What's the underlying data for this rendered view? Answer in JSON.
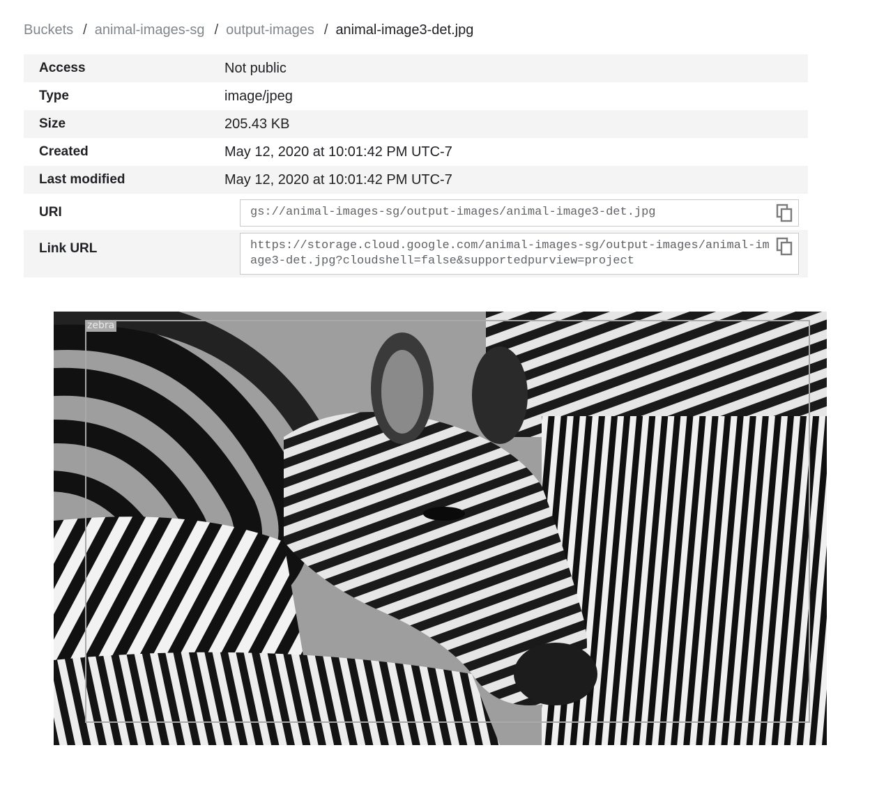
{
  "breadcrumb": {
    "items": [
      "Buckets",
      "animal-images-sg",
      "output-images"
    ],
    "separator": "/",
    "current": "animal-image3-det.jpg"
  },
  "details": {
    "access": {
      "label": "Access",
      "value": "Not public"
    },
    "type": {
      "label": "Type",
      "value": "image/jpeg"
    },
    "size": {
      "label": "Size",
      "value": "205.43 KB"
    },
    "created": {
      "label": "Created",
      "value": "May 12, 2020 at 10:01:42 PM UTC-7"
    },
    "modified": {
      "label": "Last modified",
      "value": "May 12, 2020 at 10:01:42 PM UTC-7"
    },
    "uri": {
      "label": "URI",
      "value": "gs://animal-images-sg/output-images/animal-image3-det.jpg"
    },
    "link": {
      "label": "Link URL",
      "value": "https://storage.cloud.google.com/animal-images-sg/output-images/animal-image3-det.jpg?cloudshell=false&supportedpurview=project"
    }
  },
  "icons": {
    "copy": "copy-icon"
  },
  "preview": {
    "detection_label": "zebra",
    "box_color": "#a9a9a9"
  }
}
